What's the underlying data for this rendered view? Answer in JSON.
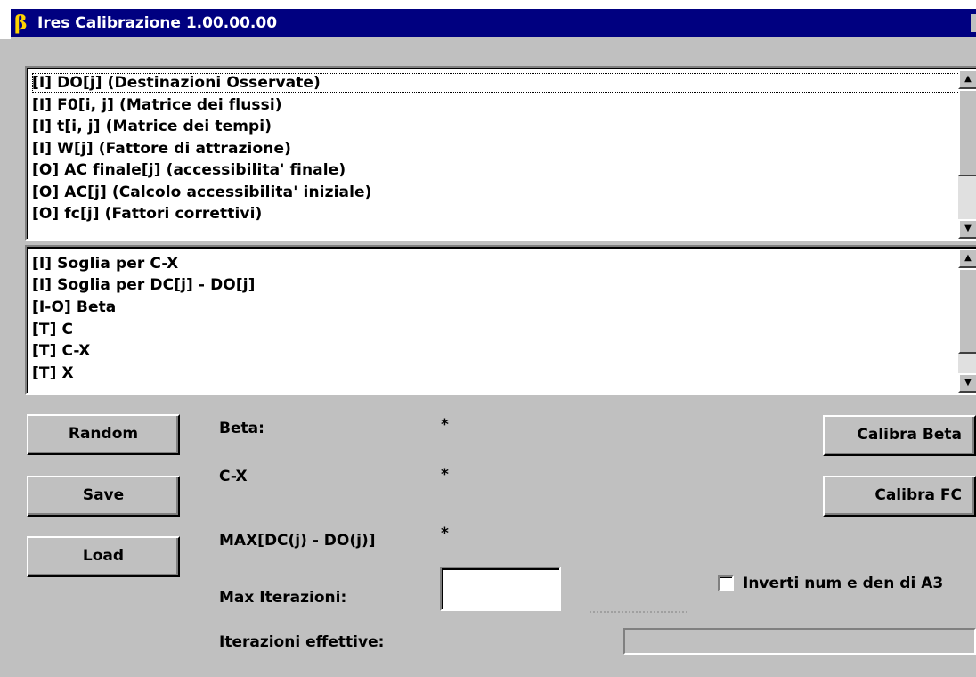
{
  "window": {
    "title": "Ires Calibrazione 1.00.00.00",
    "title_icon": "β"
  },
  "list_top": {
    "items": [
      "[I] DO[j] (Destinazioni Osservate)",
      "[I] F0[i, j] (Matrice dei flussi)",
      "[I] t[i, j] (Matrice dei tempi)",
      "[I] W[j] (Fattore di attrazione)",
      "[O] AC finale[j] (accessibilita' finale)",
      "[O] AC[j] (Calcolo accessibilita' iniziale)",
      "[O] fc[j] (Fattori correttivi)"
    ]
  },
  "list_bottom": {
    "items": [
      "[I] Soglia per C-X",
      "[I] Soglia per DC[j] - DO[j]",
      "[I-O] Beta",
      "[T] C",
      "[T] C-X",
      "[T] X"
    ]
  },
  "buttons": {
    "random": "Random",
    "save": "Save",
    "load": "Load",
    "calibra_beta": "Calibra Beta",
    "calibra_fc": "Calibra FC"
  },
  "stats": {
    "beta_label": "Beta:",
    "beta_value": "*",
    "cx_label": "C-X",
    "cx_value": "*",
    "max_label": "MAX[DC(j) - DO(j)]",
    "max_value": "*",
    "max_iter_label": "Max Iterazioni:",
    "max_iter_value": "",
    "iter_eff_label": "Iterazioni effettive:"
  },
  "checkbox": {
    "label": "Inverti num e den di A3",
    "checked": false
  },
  "progress": {
    "value": 0
  }
}
